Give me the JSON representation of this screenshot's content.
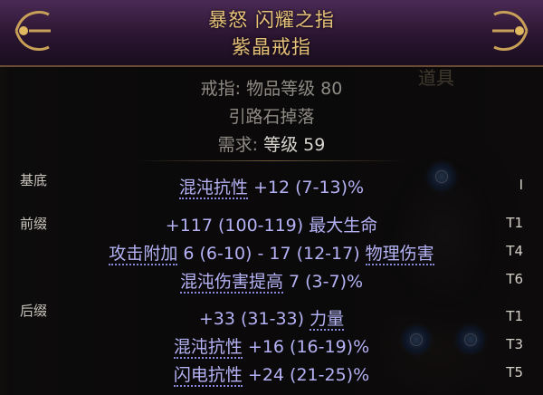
{
  "background": {
    "stash_label": "道具"
  },
  "item": {
    "name": "暴怒 闪耀之指",
    "base_type": "紫晶戒指",
    "category_line": "戒指: 物品等级 80",
    "source_line": "引路石掉落",
    "requirement_label": "需求:",
    "requirement_value": "等级 59",
    "rarity_color": "#e6c17a"
  },
  "sections": {
    "implicit": "基底",
    "prefix": "前缀",
    "suffix": "后缀"
  },
  "mods": [
    {
      "prefix": "",
      "u1": "混沌抗性",
      "mid": " +12 (7-13)%",
      "u2": "",
      "tail": "",
      "tier": "I"
    },
    {
      "prefix": "+117 (100-119) 最大生命",
      "u1": "",
      "mid": "",
      "u2": "",
      "tail": "",
      "tier": "T1"
    },
    {
      "prefix": "",
      "u1": "攻击附加",
      "mid": " 6 (6-10) - 17 (12-17) ",
      "u2": "物理伤害",
      "tail": "",
      "tier": "T4"
    },
    {
      "prefix": "",
      "u1": "混沌伤害提高",
      "mid": " 7 (3-7)%",
      "u2": "",
      "tail": "",
      "tier": "T6"
    },
    {
      "prefix": "+33 (31-33) ",
      "u1": "力量",
      "mid": "",
      "u2": "",
      "tail": "",
      "tier": "T1"
    },
    {
      "prefix": "",
      "u1": "混沌抗性",
      "mid": " +16 (16-19)%",
      "u2": "",
      "tail": "",
      "tier": "T3"
    },
    {
      "prefix": "",
      "u1": "闪电抗性",
      "mid": " +24 (21-25)%",
      "u2": "",
      "tail": "",
      "tier": "T5"
    }
  ],
  "colors": {
    "mod_text": "#b4b2f4",
    "header_gold": "#e6c17a"
  }
}
